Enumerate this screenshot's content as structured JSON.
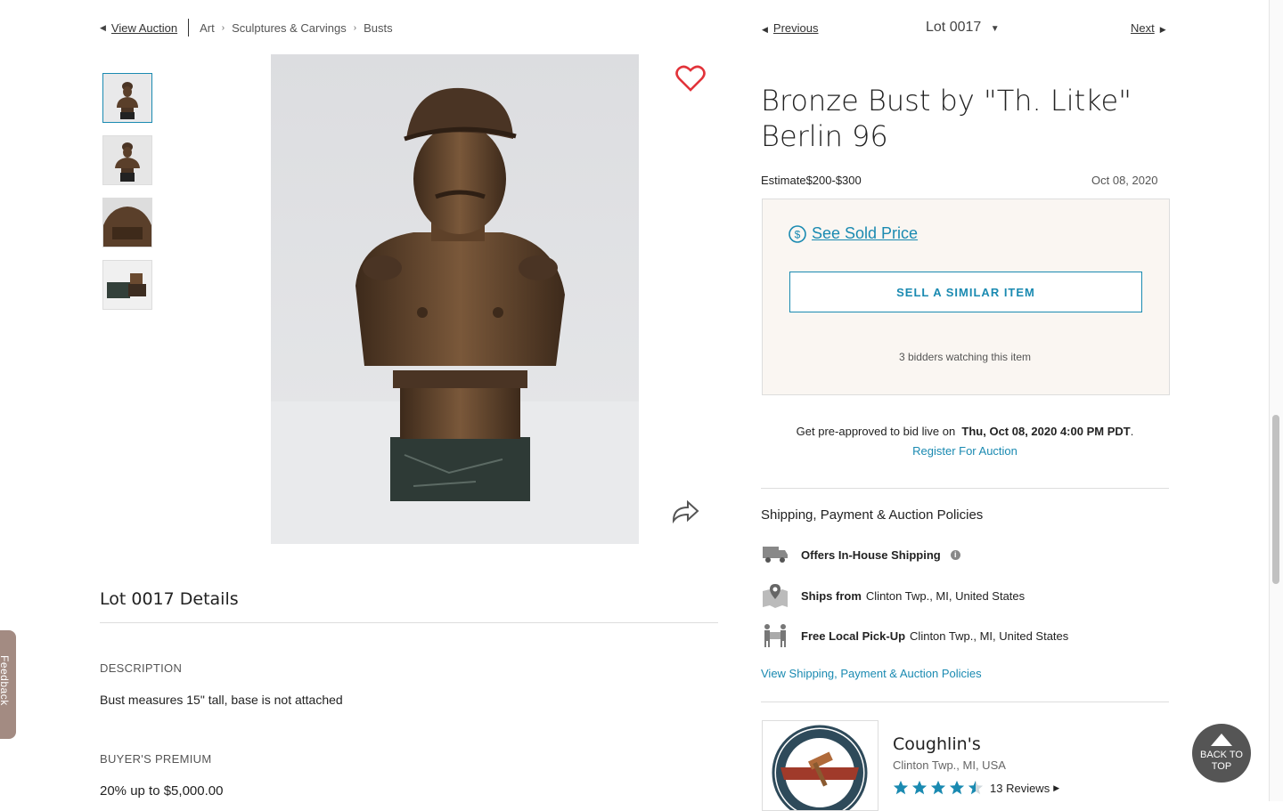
{
  "breadcrumb": {
    "view_auction": "View Auction",
    "crumbs": [
      "Art",
      "Sculptures & Carvings",
      "Busts"
    ]
  },
  "lot_nav": {
    "previous": "Previous",
    "lot_select": "Lot 0017",
    "next": "Next"
  },
  "lot": {
    "title_line1": "Bronze Bust by \"Th. Litke\"",
    "title_line2": "Berlin 96",
    "estimate_label": "Estimate",
    "estimate_value": "$200-$300",
    "date": "Oct 08, 2020"
  },
  "panel": {
    "sold_price": "See Sold Price",
    "sell_button": "SELL A SIMILAR ITEM",
    "watching": "3 bidders watching this item"
  },
  "preapprove": {
    "text": "Get pre-approved to bid live on",
    "datetime": "Thu, Oct 08, 2020 4:00 PM PDT",
    "period": ".",
    "register": "Register For Auction"
  },
  "shipping": {
    "title": "Shipping, Payment & Auction Policies",
    "inhouse": "Offers In-House Shipping",
    "ships_from_label": "Ships from",
    "ships_from_value": "Clinton Twp., MI, United States",
    "pickup_label": "Free Local Pick-Up",
    "pickup_value": "Clinton Twp., MI, United States",
    "link": "View Shipping, Payment & Auction Policies"
  },
  "seller": {
    "name": "Coughlin's",
    "location": "Clinton Twp., MI, USA",
    "rating": 4.5,
    "reviews": "13 Reviews"
  },
  "details": {
    "title": "Lot 0017 Details",
    "description_label": "DESCRIPTION",
    "description": "Bust measures 15\" tall, base is not attached",
    "premium_label": "BUYER'S PREMIUM",
    "premium": "20% up to $5,000.00"
  },
  "back_to_top": [
    "BACK TO",
    "TOP"
  ],
  "feedback": "Feedback",
  "colors": {
    "accent": "#1a8ab1",
    "heart": "#e2333a",
    "panel_bg": "#faf6f2"
  }
}
